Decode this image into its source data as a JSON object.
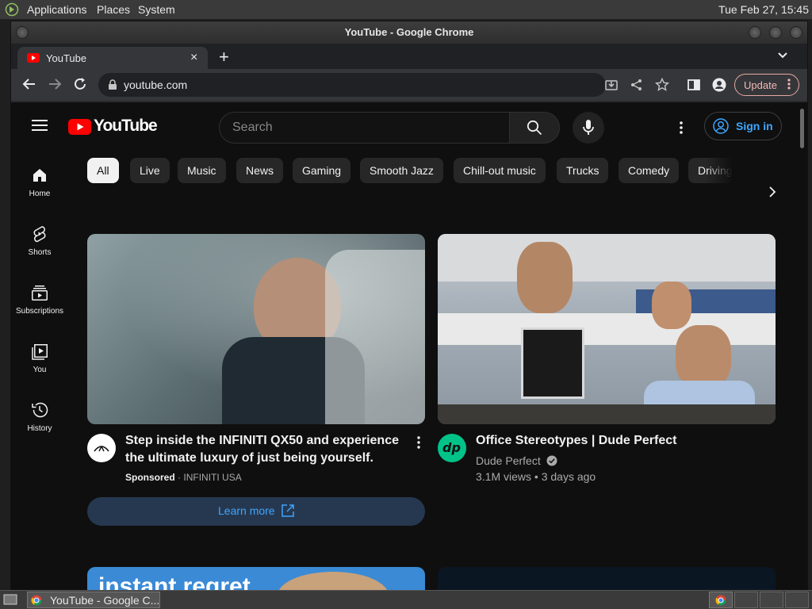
{
  "panel": {
    "applications": "Applications",
    "places": "Places",
    "system": "System",
    "clock": "Tue Feb 27, 15:45"
  },
  "window": {
    "title": "YouTube - Google Chrome"
  },
  "browser": {
    "tab_title": "YouTube",
    "tab_close": "×",
    "new_tab": "+",
    "url": "youtube.com",
    "update_label": "Update"
  },
  "youtube": {
    "logo_text": "YouTube",
    "search_placeholder": "Search",
    "sign_in": "Sign in",
    "sidebar": [
      {
        "label": "Home",
        "icon": "home-icon"
      },
      {
        "label": "Shorts",
        "icon": "shorts-icon"
      },
      {
        "label": "Subscriptions",
        "icon": "subscriptions-icon"
      },
      {
        "label": "You",
        "icon": "you-icon"
      },
      {
        "label": "History",
        "icon": "history-icon"
      }
    ],
    "chips": [
      "All",
      "Live",
      "Music",
      "News",
      "Gaming",
      "Smooth Jazz",
      "Chill-out music",
      "Trucks",
      "Comedy",
      "Driving"
    ],
    "ad": {
      "title": "Step inside the INFINITI QX50 and experience the ultimate luxury of just being yourself.",
      "sponsored": "Sponsored",
      "separator": "·",
      "advertiser": "INFINITI USA",
      "cta": "Learn more"
    },
    "video": {
      "title": "Office Stereotypes | Dude Perfect",
      "channel": "Dude Perfect",
      "views": "3.1M views",
      "separator": "•",
      "age": "3 days ago"
    },
    "next_thumb_text": "instant regret"
  },
  "taskbar": {
    "window_label": "YouTube - Google C..."
  },
  "colors": {
    "yt_red": "#ff0000",
    "sign_in_blue": "#3ea6ff",
    "verified_gray": "#aaaaaa"
  }
}
